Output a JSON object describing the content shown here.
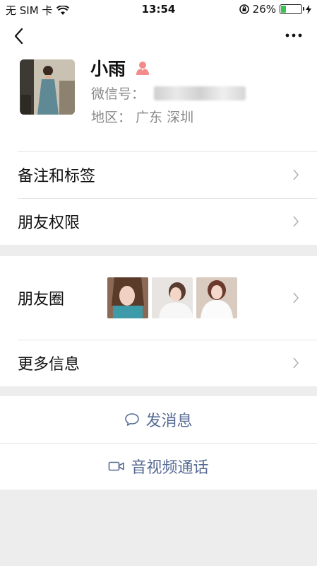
{
  "status_bar": {
    "carrier": "无 SIM 卡",
    "time": "13:54",
    "battery_percent": "26%",
    "battery_level": 0.26
  },
  "profile": {
    "name": "小雨",
    "wechat_id_label": "微信号：",
    "region": "地区：  广东  深圳"
  },
  "menu": {
    "remarks_tags": "备注和标签",
    "friend_permissions": "朋友权限",
    "moments": "朋友圈",
    "more_info": "更多信息"
  },
  "actions": {
    "send_message": "发消息",
    "video_call": "音视频通话"
  },
  "colors": {
    "link": "#576b95",
    "background": "#ededed",
    "battery": "#3cc153",
    "gender_icon": "#f28b8b"
  }
}
